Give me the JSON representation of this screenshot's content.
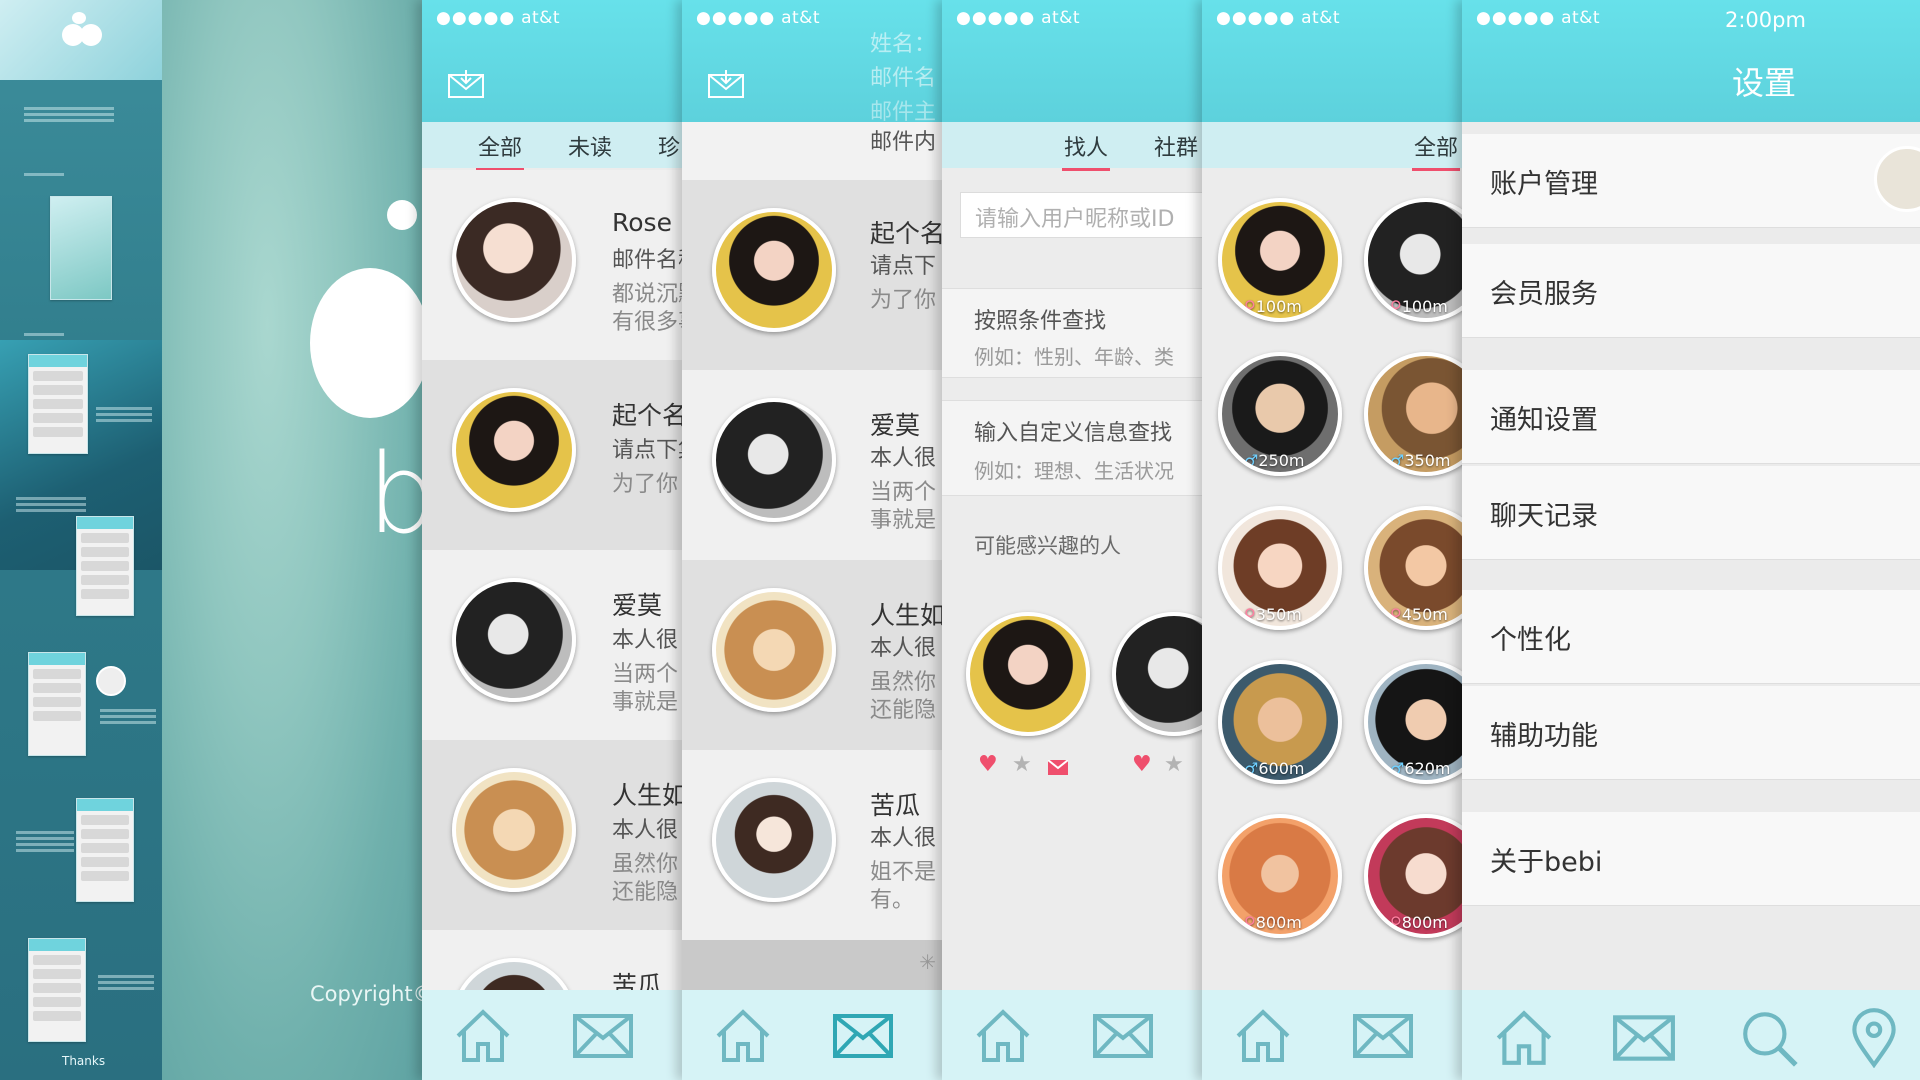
{
  "overview": {
    "thanks": "Thanks"
  },
  "splash": {
    "letter": "b",
    "copyright": "Copyright©"
  },
  "status": {
    "dots": "●●●●●",
    "carrier": "at&t",
    "time": "2:00pm"
  },
  "mail_list": {
    "tabs": [
      "全部",
      "未读",
      "珍"
    ],
    "items": [
      {
        "name": "Rose",
        "lines": [
          "邮件名称",
          "都说沉默",
          "有很多事"
        ]
      },
      {
        "name": "起个名",
        "lines": [
          "请点下集",
          "为了你"
        ]
      },
      {
        "name": "爱莫",
        "lines": [
          "本人很",
          "当两个",
          "事就是"
        ]
      },
      {
        "name": "人生如",
        "lines": [
          "本人很",
          "虽然你",
          "还能隐"
        ]
      },
      {
        "name": "苦瓜",
        "lines": []
      }
    ]
  },
  "mail_list2": {
    "overlay_fields": [
      "姓名：",
      "邮件名",
      "邮件主",
      "邮件内"
    ],
    "items": [
      {
        "name": "起个名",
        "lines": [
          "请点下",
          "为了你"
        ]
      },
      {
        "name": "爱莫",
        "lines": [
          "本人很",
          "当两个",
          "事就是"
        ]
      },
      {
        "name": "人生如",
        "lines": [
          "本人很",
          "虽然你",
          "还能隐"
        ]
      },
      {
        "name": "苦瓜",
        "lines": [
          "本人很",
          "姐不是",
          "有。"
        ]
      }
    ]
  },
  "find": {
    "tabs": [
      "找人",
      "社群"
    ],
    "search_placeholder": "请输入用户昵称或ID",
    "by_condition": "按照条件查找",
    "by_condition_hint": "例如：性别、年龄、类",
    "by_custom": "输入自定义信息查找",
    "by_custom_hint": "例如：理想、生活状况",
    "interest_label": "可能感兴趣的人"
  },
  "nearby": {
    "tab": "全部",
    "people": [
      {
        "dist": "100m",
        "gender": "f"
      },
      {
        "dist": "100m",
        "gender": "f"
      },
      {
        "dist": "250m",
        "gender": "m"
      },
      {
        "dist": "350m",
        "gender": "m"
      },
      {
        "dist": "350m",
        "gender": "f"
      },
      {
        "dist": "450m",
        "gender": "f"
      },
      {
        "dist": "600m",
        "gender": "m"
      },
      {
        "dist": "620m",
        "gender": "m"
      },
      {
        "dist": "800m",
        "gender": "f"
      },
      {
        "dist": "800m",
        "gender": "f"
      }
    ]
  },
  "settings": {
    "title": "设置",
    "items": [
      "账户管理",
      "会员服务",
      "通知设置",
      "聊天记录",
      "个性化",
      "辅助功能",
      "关于bebi"
    ]
  },
  "colors": {
    "teal": "#5dd1dc",
    "accent": "#ef4f6d",
    "nav_icon": "#6fb8c2"
  }
}
